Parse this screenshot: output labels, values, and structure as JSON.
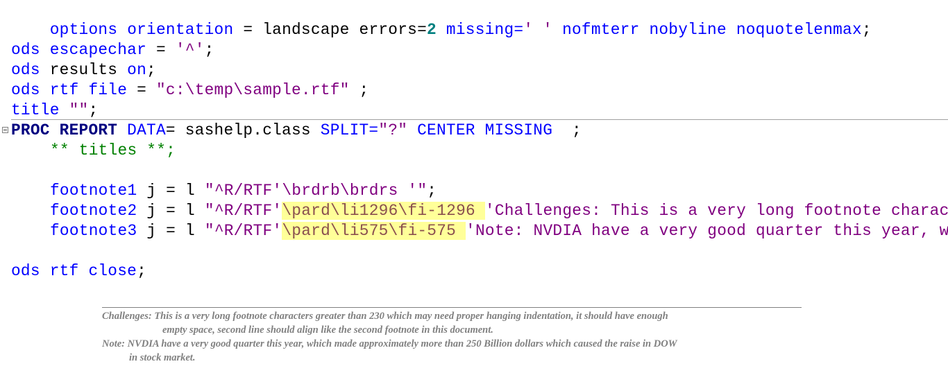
{
  "editor": {
    "lines": {
      "options": {
        "kw1": "options",
        "kw2": "orientation",
        "eq": " = landscape errors=",
        "num": "2",
        "missing_kw": " missing=",
        "missing_val": "' '",
        "rest": " nofmterr nobyline noquotelenmax",
        "semi": ";"
      },
      "escapechar": {
        "kw": "ods escapechar",
        "eq": " = ",
        "str": "'^'",
        "semi": ";"
      },
      "results": {
        "kw": "ods",
        "mid": " results ",
        "on": "on",
        "semi": ";"
      },
      "rtf_file": {
        "kw": "ods rtf file",
        "eq": " = ",
        "str": "\"c:\\temp\\sample.rtf\"",
        "semi": " ;"
      },
      "title": {
        "kw": "title",
        "str": " \"\"",
        "semi": ";"
      },
      "proc": {
        "proc": "PROC REPORT",
        "data_kw": " DATA",
        "data_val": "= sashelp.class ",
        "split_kw": "SPLIT=",
        "split_val": "\"?\"",
        "opts": " CENTER MISSING",
        "semi": "  ;"
      },
      "comment": "** titles **;",
      "footnote1": {
        "kw": "footnote1",
        "j": " j = l ",
        "str": "\"^R/RTF'\\brdrb\\brdrs '\"",
        "semi": ";"
      },
      "footnote2": {
        "kw": "footnote2",
        "j": " j = l ",
        "str_pre": "\"^R/RTF'",
        "highlight": "\\pard\\li1296\\fi-1296 ",
        "str_post": "'Challenges: This is a very long footnote charac"
      },
      "footnote3": {
        "kw": "footnote3",
        "j": " j = l ",
        "str_pre": "\"^R/RTF'",
        "highlight": "\\pard\\li575\\fi-575 ",
        "str_post": "'Note: NVDIA have a very good quarter this year, w"
      },
      "close": {
        "kw": "ods rtf close",
        "semi": ";"
      }
    }
  },
  "output": {
    "footnote2_line1": "Challenges: This is a very long footnote characters greater than 230 which may need proper hanging indentation, it should have enough",
    "footnote2_line2": "empty space, second line should align like the second footnote in this document.",
    "footnote3_line1": "Note: NVDIA have a very good quarter this year, which made approximately more than 250 Billion dollars which caused the raise in DOW",
    "footnote3_line2": "in stock market."
  }
}
